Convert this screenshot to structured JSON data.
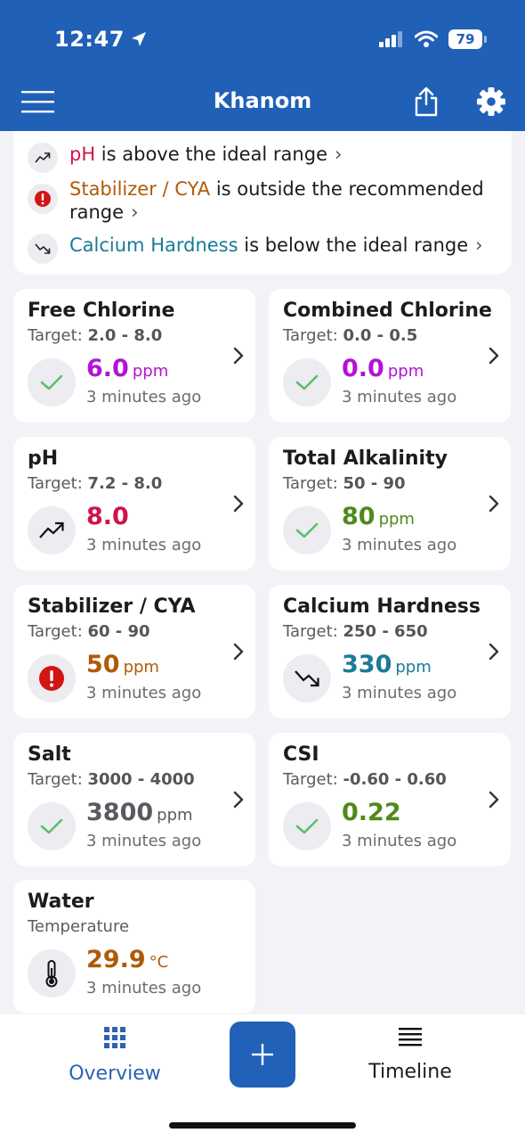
{
  "status_bar": {
    "time": "12:47",
    "battery": "79"
  },
  "nav": {
    "title": "Khanom"
  },
  "alerts": [
    {
      "param": "pH",
      "message": " is above the ideal range",
      "color": "#d0134a",
      "icon": "trending-up-icon"
    },
    {
      "param": "Stabilizer / CYA",
      "message": " is outside the recommended range",
      "color": "#b05a07",
      "icon": "alert-icon"
    },
    {
      "param": "Calcium Hardness",
      "message": " is below the ideal range",
      "color": "#1a7a99",
      "icon": "trending-down-icon"
    }
  ],
  "target_label": "Target: ",
  "cards": [
    {
      "title": "Free Chlorine",
      "target": "2.0 - 8.0",
      "value": "6.0",
      "unit": "ppm",
      "time": "3 minutes ago",
      "color": "#b312d6",
      "status": "check-icon"
    },
    {
      "title": "Combined Chlorine",
      "target": "0.0 - 0.5",
      "value": "0.0",
      "unit": "ppm",
      "time": "3 minutes ago",
      "color": "#b312d6",
      "status": "check-icon"
    },
    {
      "title": "pH",
      "target": "7.2 - 8.0",
      "value": "8.0",
      "unit": "",
      "time": "3 minutes ago",
      "color": "#d0134a",
      "status": "trending-up-icon"
    },
    {
      "title": "Total Alkalinity",
      "target": "50 - 90",
      "value": "80",
      "unit": "ppm",
      "time": "3 minutes ago",
      "color": "#4f8a1c",
      "status": "check-icon"
    },
    {
      "title": "Stabilizer / CYA",
      "target": "60 - 90",
      "value": "50",
      "unit": "ppm",
      "time": "3 minutes ago",
      "color": "#b05a07",
      "status": "alert-icon"
    },
    {
      "title": "Calcium Hardness",
      "target": "250 - 650",
      "value": "330",
      "unit": "ppm",
      "time": "3 minutes ago",
      "color": "#1a7a99",
      "status": "trending-down-icon"
    },
    {
      "title": "Salt",
      "target": "3000 - 4000",
      "value": "3800",
      "unit": "ppm",
      "time": "3 minutes ago",
      "color": "#5a5a60",
      "status": "check-icon"
    },
    {
      "title": "CSI",
      "target": "-0.60 - 0.60",
      "value": "0.22",
      "unit": "",
      "time": "3 minutes ago",
      "color": "#4f8a1c",
      "status": "check-icon"
    }
  ],
  "water_card": {
    "title": "Water",
    "subtitle": "Temperature",
    "value": "29.9",
    "unit": "°C",
    "time": "3 minutes ago",
    "color": "#b05a07",
    "status": "thermometer-icon"
  },
  "tabbar": {
    "overview": "Overview",
    "timeline": "Timeline",
    "add": "+"
  }
}
